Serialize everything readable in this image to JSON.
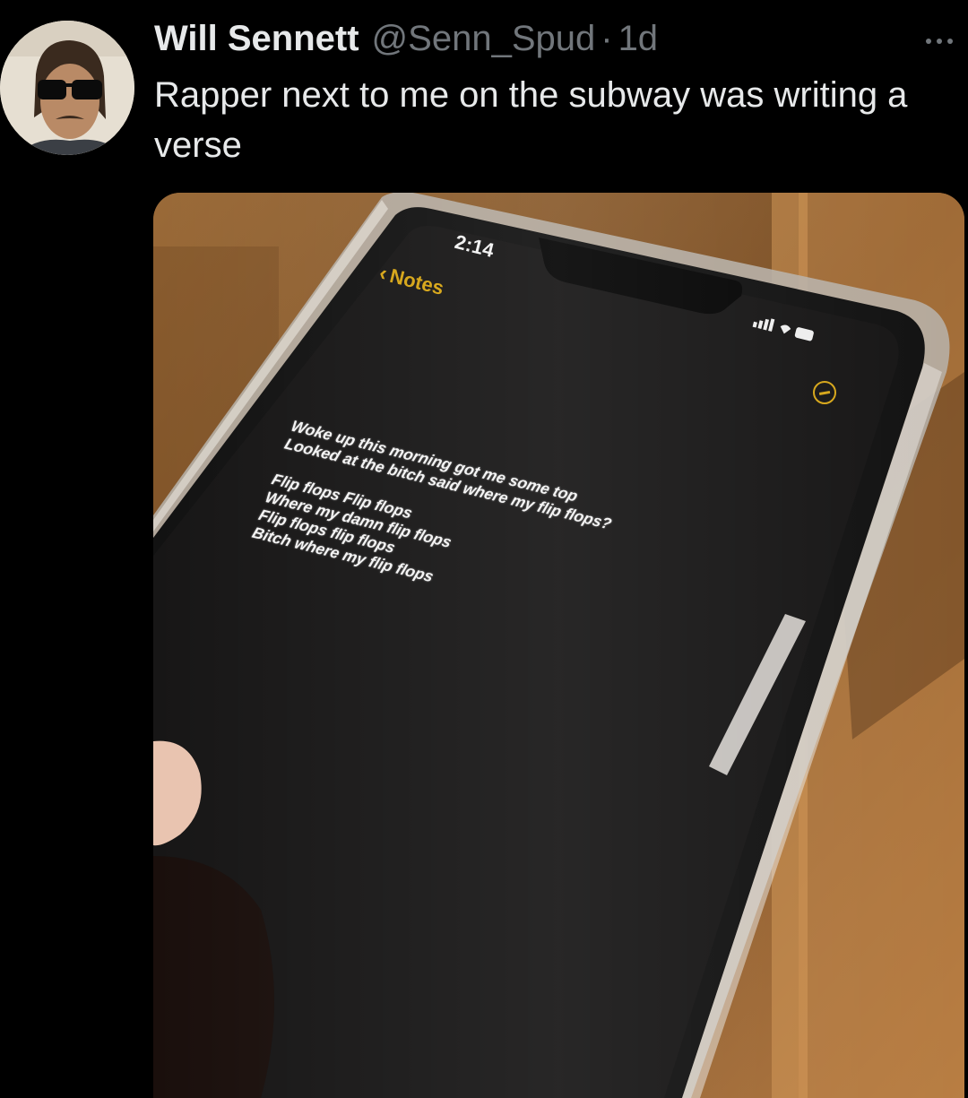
{
  "tweet": {
    "display_name": "Will Sennett",
    "handle": "@Senn_Spud",
    "separator": "·",
    "time_ago": "1d",
    "text": "Rapper next to me on the subway was writing a verse"
  },
  "icons": {
    "more": "more-horizontal-icon",
    "back": "chevron-left-icon",
    "done": "circle-minus-icon"
  },
  "photo": {
    "status_time": "2:14",
    "back_label": "Notes",
    "lines": [
      "Woke up this morning got me some top",
      "Looked at the bitch said where my flip flops?",
      "",
      "Flip flops Flip flops",
      "Where my damn flip flops",
      "Flip flops flip flops",
      "Bitch where my flip flops"
    ]
  },
  "colors": {
    "background": "#000000",
    "text_primary": "#e7e9ea",
    "text_secondary": "#71767b",
    "notes_accent": "#d7a81e"
  }
}
